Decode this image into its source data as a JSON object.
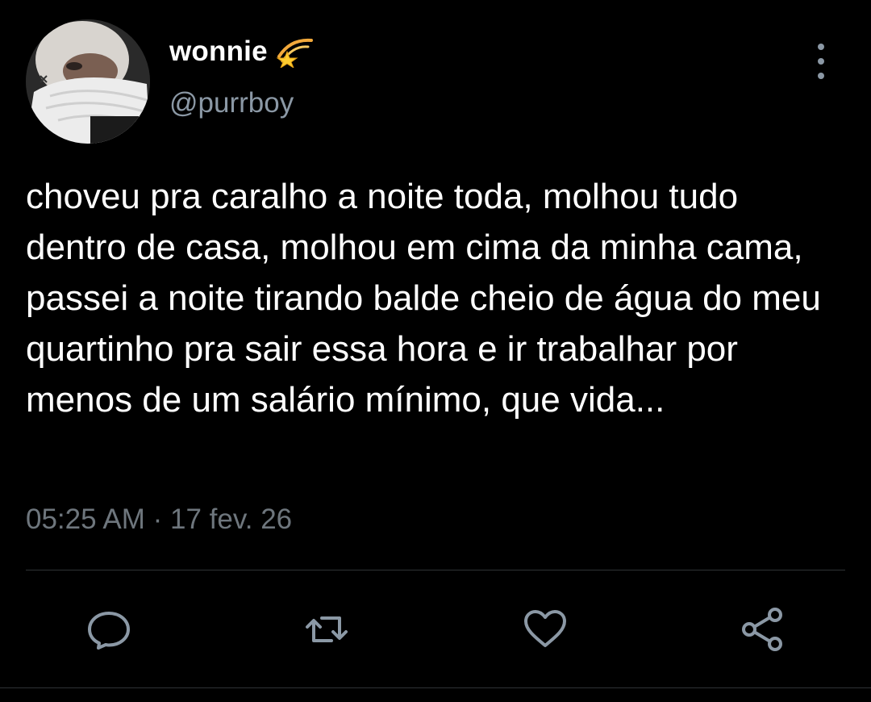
{
  "user": {
    "display_name": "wonnie",
    "name_emoji": "dizzy-star-emoji",
    "handle": "@purrboy",
    "avatar": "profile-photo"
  },
  "tweet": {
    "text": "choveu pra caralho a noite toda, molhou tudo dentro de casa, molhou em cima da minha cama, passei a noite tirando balde cheio de água do meu quartinho pra sair essa hora e ir trabalhar por menos de um salário mínimo, que vida...",
    "time": "05:25 AM",
    "separator": "·",
    "date": "17 fev. 26"
  },
  "actions": {
    "reply_icon": "speech-bubble-icon",
    "retweet_icon": "retweet-arrows-icon",
    "like_icon": "heart-icon",
    "share_icon": "share-nodes-icon",
    "more_icon": "vertical-dots-icon"
  },
  "colors": {
    "background": "#000000",
    "text_primary": "#ffffff",
    "text_secondary": "#8b98a5",
    "meta_text": "#6e767d",
    "divider": "#2f3336",
    "icon": "#8b98a5"
  }
}
